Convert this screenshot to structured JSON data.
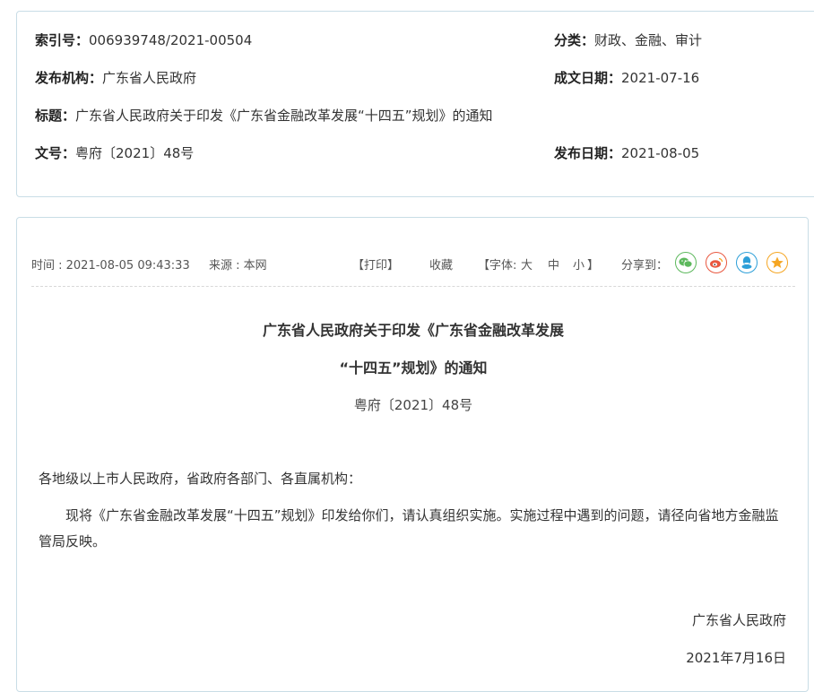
{
  "meta": {
    "index_label": "索引号：",
    "index_value": "006939748/2021-00504",
    "category_label": "分类：",
    "category_value": "财政、金融、审计",
    "publisher_label": "发布机构：",
    "publisher_value": "广东省人民政府",
    "written_date_label": "成文日期：",
    "written_date_value": "2021-07-16",
    "title_label": "标题：",
    "title_value": "广东省人民政府关于印发《广东省金融改革发展“十四五”规划》的通知",
    "doc_no_label": "文号：",
    "doc_no_value": "粤府〔2021〕48号",
    "pub_date_label": "发布日期：",
    "pub_date_value": "2021-08-05"
  },
  "info_bar": {
    "time": "时间 : 2021-08-05 09:43:33",
    "source": "来源 : 本网",
    "print": "【打印】",
    "favorite": "收藏",
    "font_label": "【字体:",
    "font_large": "大",
    "font_medium": "中",
    "font_small": "小",
    "font_end": "】",
    "share_label": "分享到："
  },
  "share_icons": [
    "wechat-icon",
    "weibo-icon",
    "qq-icon",
    "qzone-star-icon"
  ],
  "colors": {
    "wechat": "#5cb85c",
    "weibo": "#e9573f",
    "qq": "#2d9fd8",
    "qzone": "#f5a623"
  },
  "article": {
    "title_line1": "广东省人民政府关于印发《广东省金融改革发展",
    "title_line2": "“十四五”规划》的通知",
    "doc_no": "粤府〔2021〕48号",
    "salutation": "各地级以上市人民政府，省政府各部门、各直属机构：",
    "body": "现将《广东省金融改革发展“十四五”规划》印发给你们，请认真组织实施。实施过程中遇到的问题，请径向省地方金融监管局反映。",
    "signature": "广东省人民政府",
    "date": "2021年7月16日"
  }
}
